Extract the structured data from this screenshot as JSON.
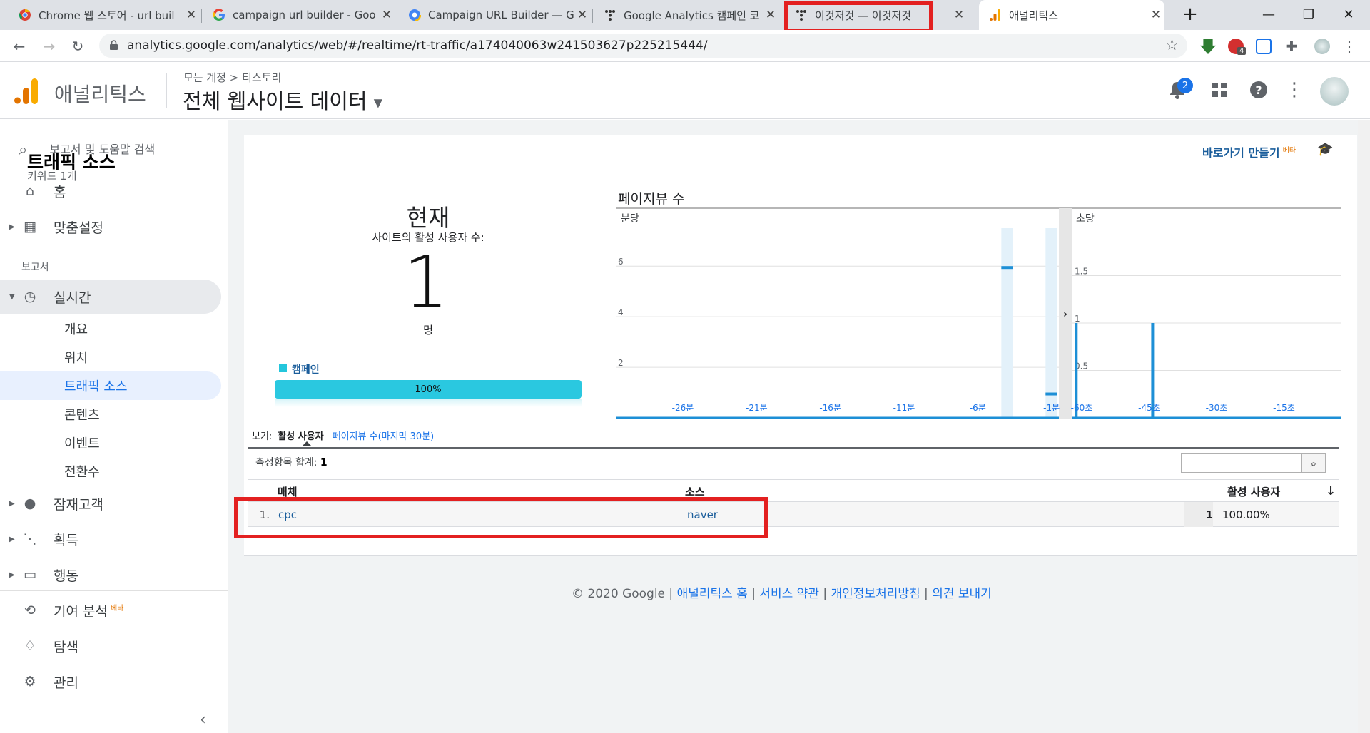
{
  "browser": {
    "tabs": [
      {
        "title": "Chrome 웹 스토어 - url buil",
        "icon": "chrome-webstore-icon"
      },
      {
        "title": "campaign url builder - Goo",
        "icon": "google-icon"
      },
      {
        "title": "Campaign URL Builder — G",
        "icon": "ga-dev-tools-icon"
      },
      {
        "title": "Google Analytics 캠페인 코",
        "icon": "tistory-icon"
      },
      {
        "title": "이것저것 — 이것저것",
        "icon": "tistory-icon"
      },
      {
        "title": "애널리틱스",
        "icon": "analytics-icon"
      }
    ],
    "url": "analytics.google.com/analytics/web/#/realtime/rt-traffic/a174040063w241503627p225215444/",
    "ext_badge": "4"
  },
  "header": {
    "product": "애널리틱스",
    "breadcrumb_account": "모든 계정",
    "breadcrumb_sep": ">",
    "breadcrumb_property": "티스토리",
    "view": "전체 웹사이트 데이터",
    "notifications": "2"
  },
  "sidebar": {
    "search": "보고서 및 도움말 검색",
    "home": "홈",
    "customization": "맞춤설정",
    "section_reports": "보고서",
    "realtime": "실시간",
    "realtime_sub": [
      "개요",
      "위치",
      "트래픽 소스",
      "콘텐츠",
      "이벤트",
      "전환수"
    ],
    "audience": "잠재고객",
    "acquisition": "획득",
    "behavior": "행동",
    "attribution": "기여 분석",
    "attribution_badge": "베타",
    "discover": "탐색",
    "admin": "관리"
  },
  "report": {
    "title": "트래픽 소스",
    "subtitle": "키워드 1개",
    "shortcut": "바로가기 만들기",
    "shortcut_badge": "베타",
    "now_label": "현재",
    "active_label": "사이트의 활성 사용자 수:",
    "active_count": "1",
    "unit": "명",
    "legend": "캠페인",
    "share": "100%",
    "share_fraction": 1.0,
    "pageviews_title": "페이지뷰 수",
    "per_minute_label": "분당",
    "per_second_label": "초당",
    "view_prefix": "보기:",
    "view_active": "활성 사용자",
    "view_link": "페이지뷰 수(마지막 30분)",
    "metric_total_label": "측정항목 합계:",
    "metric_total": "1",
    "columns": [
      "매체",
      "소스",
      "활성 사용자"
    ],
    "rows": [
      {
        "index": "1.",
        "medium": "cpc",
        "source": "naver",
        "active": "1",
        "percent": "100.00%"
      }
    ]
  },
  "chart_data": [
    {
      "type": "bar",
      "title": "분당",
      "y_ticks": [
        "2",
        "4",
        "6"
      ],
      "x_tick_labels": [
        "-26분",
        "-21분",
        "-16분",
        "-11분",
        "-6분",
        "-1분"
      ],
      "ylim": [
        0,
        7.5
      ],
      "x": [
        -30,
        -29,
        -28,
        -27,
        -26,
        -25,
        -24,
        -23,
        -22,
        -21,
        -20,
        -19,
        -18,
        -17,
        -16,
        -15,
        -14,
        -13,
        -12,
        -11,
        -10,
        -9,
        -8,
        -7,
        -6,
        -5,
        -4,
        -3,
        -2,
        -1
      ],
      "values": [
        0,
        0,
        0,
        0,
        0,
        0,
        0,
        0,
        0,
        0,
        0,
        0,
        0,
        0,
        0,
        0,
        0,
        0,
        0,
        0,
        0,
        0,
        0,
        0,
        0,
        0,
        6,
        0,
        0,
        1
      ]
    },
    {
      "type": "bar",
      "title": "초당",
      "y_ticks": [
        "0.5",
        "1",
        "1.5"
      ],
      "x_tick_labels": [
        "-60초",
        "-45초",
        "-30초",
        "-15초"
      ],
      "ylim": [
        0,
        2
      ],
      "x": [
        -59,
        -42
      ],
      "values": [
        1,
        1
      ]
    }
  ],
  "footer": {
    "copyright": "© 2020 Google |",
    "links": [
      "애널리틱스 홈",
      "서비스 약관",
      "개인정보처리방침",
      "의견 보내기"
    ],
    "sep": "|"
  }
}
